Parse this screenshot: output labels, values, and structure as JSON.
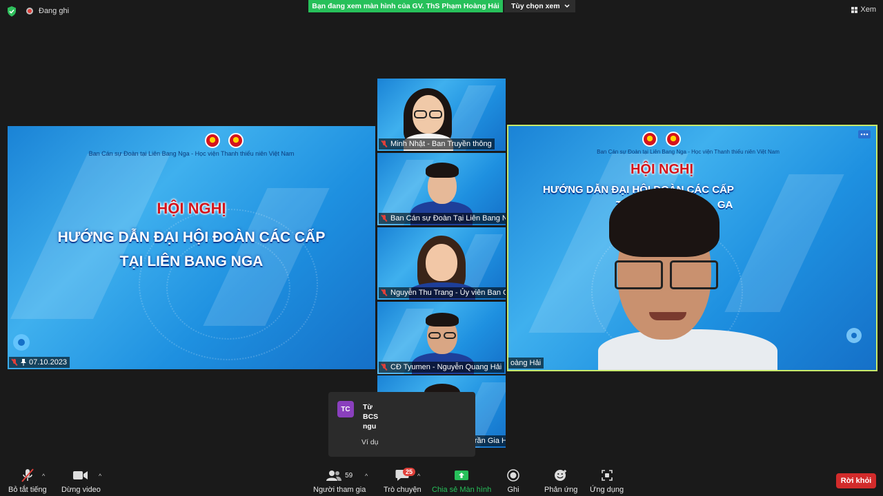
{
  "top": {
    "recording": "Đang ghi",
    "share_banner": "Bạn đang xem màn hình của GV. ThS Phạm Hoàng Hải",
    "view_options": "Tùy chọn xem",
    "view": "Xem"
  },
  "slide": {
    "org_line": "Ban Cán sự Đoàn tại Liên Bang Nga - Học viện Thanh thiếu niên Việt Nam",
    "title": "HỘI NGHỊ",
    "subtitle1": "HƯỚNG DẪN ĐẠI HỘI ĐOÀN CÁC CẤP",
    "subtitle2": "TẠI LIÊN BANG NGA",
    "date_label": "07.10.2023"
  },
  "speaker": {
    "title": "HỘI NGHỊ",
    "subtitle1": "HƯỚNG DẪN ĐẠI HỘI ĐOÀN CÁC CẤP",
    "subtitle2_partial": "TA",
    "subtitle2_tail": "GA",
    "name_partial": "oàng Hải"
  },
  "participants": [
    {
      "name": "Minh Nhật - Ban Truyền thông"
    },
    {
      "name": "Ban Cán sự Đoàn Tại Liên Bang Nga"
    },
    {
      "name": "Nguyễn Thu Trang - Ủy viên Ban C..."
    },
    {
      "name": "CĐ Tyumen - Nguyễn Quang Hải"
    },
    {
      "name": "Liên chi đoàn TP Tula - Trần Gia H..."
    }
  ],
  "chat_toast": {
    "avatar": "TC",
    "line1": "Từ",
    "line2": "BCS",
    "line3": "ngu",
    "preview": "Ví dụ"
  },
  "toolbar": {
    "mute": "Bỏ tắt tiếng",
    "stop_video": "Dừng video",
    "participants": "Người tham gia",
    "participants_count": "59",
    "chat": "Trò chuyện",
    "chat_badge": "25",
    "share_screen": "Chia sẻ Màn hình",
    "record": "Ghi",
    "reactions": "Phản ứng",
    "apps": "Ứng dụng",
    "leave": "Rời khỏi"
  },
  "colors": {
    "share_green": "#27c05a",
    "leave_red": "#d22b2b",
    "active_speaker_border": "#c8ea6a"
  }
}
